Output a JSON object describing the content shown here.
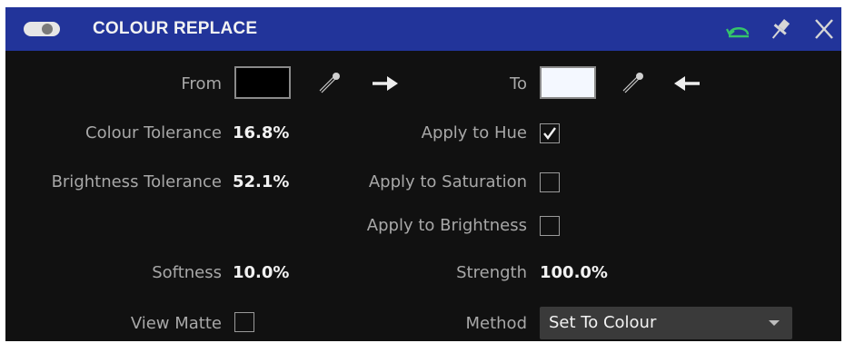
{
  "header": {
    "title": "COLOUR REPLACE",
    "enabled": true,
    "icons": [
      "toggle-switch-icon",
      "reset-icon",
      "pin-icon",
      "close-icon"
    ]
  },
  "colors": {
    "header_bg": "#22349a",
    "panel_bg": "#111111",
    "label": "#a8a8a8",
    "value": "#f2f2f2",
    "reset_icon": "#35c56a"
  },
  "swatches": {
    "from_label": "From",
    "from_color": "#000000",
    "to_label": "To",
    "to_color": "#f4f8ff",
    "from_icons": [
      "eyedropper-icon",
      "arrow-right-icon"
    ],
    "to_icons": [
      "eyedropper-icon",
      "arrow-left-icon"
    ]
  },
  "params": {
    "colour_tolerance": {
      "label": "Colour Tolerance",
      "value": "16.8%"
    },
    "brightness_tolerance": {
      "label": "Brightness Tolerance",
      "value": "52.1%"
    },
    "softness": {
      "label": "Softness",
      "value": "10.0%"
    },
    "view_matte": {
      "label": "View Matte",
      "checked": false
    },
    "apply_to_hue": {
      "label": "Apply to Hue",
      "checked": true
    },
    "apply_to_saturation": {
      "label": "Apply to Saturation",
      "checked": false
    },
    "apply_to_brightness": {
      "label": "Apply to Brightness",
      "checked": false
    },
    "strength": {
      "label": "Strength",
      "value": "100.0%"
    },
    "method": {
      "label": "Method",
      "value": "Set To Colour"
    }
  }
}
